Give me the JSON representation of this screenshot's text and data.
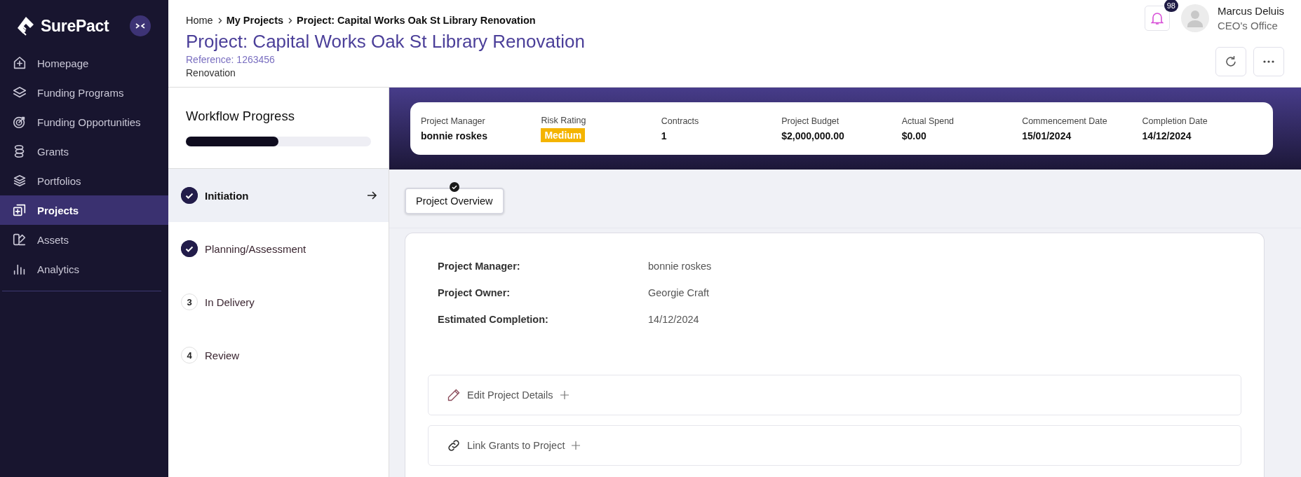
{
  "sidebar": {
    "logo": "SurePact",
    "items": [
      {
        "label": "Homepage",
        "selected": false
      },
      {
        "label": "Funding Programs",
        "selected": false
      },
      {
        "label": "Funding Opportunities",
        "selected": false
      },
      {
        "label": "Grants",
        "selected": false
      },
      {
        "label": "Portfolios",
        "selected": false
      },
      {
        "label": "Projects",
        "selected": true
      },
      {
        "label": "Assets",
        "selected": false
      },
      {
        "label": "Analytics",
        "selected": false
      }
    ]
  },
  "breadcrumb": [
    "Home",
    "My Projects",
    "Project: Capital Works Oak St Library Renovation"
  ],
  "header": {
    "title": "Project: Capital Works Oak St Library Renovation",
    "reference": "Reference: 1263456",
    "category": "Renovation"
  },
  "user": {
    "notifications": "98",
    "name": "Marcus Deluis",
    "office": "CEO's Office"
  },
  "workflow": {
    "title": "Workflow Progress",
    "level": 0.5,
    "steps": [
      {
        "label": "Initiation",
        "completed": true,
        "selected": true
      },
      {
        "label": "Planning/Assessment",
        "completed": true,
        "selected": false
      },
      {
        "label": "In Delivery",
        "number": "3",
        "completed": false,
        "selected": false
      },
      {
        "label": "Review",
        "number": "4",
        "completed": false,
        "selected": false
      }
    ]
  },
  "summary": [
    {
      "label": "Project Manager",
      "value": "bonnie roskes",
      "kind": "text"
    },
    {
      "label": "Risk Rating",
      "value": "Medium",
      "kind": "badge"
    },
    {
      "label": "Contracts",
      "value": "1",
      "kind": "text"
    },
    {
      "label": "Project Budget",
      "value": "$2,000,000.00",
      "kind": "text"
    },
    {
      "label": "Actual Spend",
      "value": "$0.00",
      "kind": "text"
    },
    {
      "label": "Commencement Date",
      "value": "15/01/2024",
      "kind": "text"
    },
    {
      "label": "Completion Date",
      "value": "14/12/2024",
      "kind": "text"
    }
  ],
  "tabs": [
    {
      "label": "Project Overview",
      "selected": true,
      "completed": true
    }
  ],
  "details": [
    {
      "label": "Project Manager:",
      "value": "bonnie roskes"
    },
    {
      "label": "Project Owner:",
      "value": "Georgie Craft"
    },
    {
      "label": "Estimated Completion:",
      "value": "14/12/2024"
    }
  ],
  "sections": [
    {
      "label": "Edit Project Details"
    },
    {
      "label": "Link Grants to Project"
    }
  ]
}
